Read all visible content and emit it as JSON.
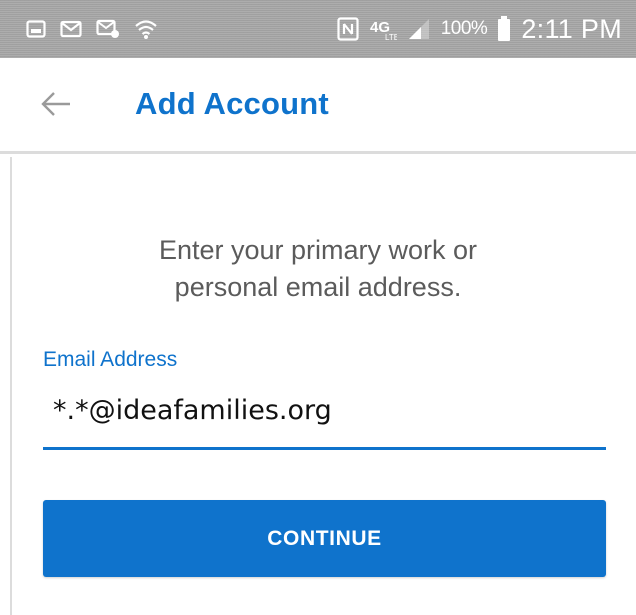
{
  "status_bar": {
    "left_icons": [
      "gallery-icon",
      "gmail-icon",
      "email-icon",
      "wifi-icon"
    ],
    "right_icons": [
      "nfc-icon",
      "4g-lte-icon",
      "signal-icon",
      "battery-icon"
    ],
    "battery_percent": "100%",
    "time": "2:11 PM"
  },
  "header": {
    "back_icon": "arrow-left-icon",
    "title": "Add Account"
  },
  "prompt": {
    "line1": "Enter your primary work or",
    "line2": "personal email address."
  },
  "email_field": {
    "label": "Email Address",
    "value": "*.*@ideafamilies.org"
  },
  "continue_button": {
    "label": "CONTINUE"
  },
  "colors": {
    "accent": "#0f73cc",
    "status_bar": "#a6a6a6",
    "prompt_text": "#5b5b5b"
  }
}
